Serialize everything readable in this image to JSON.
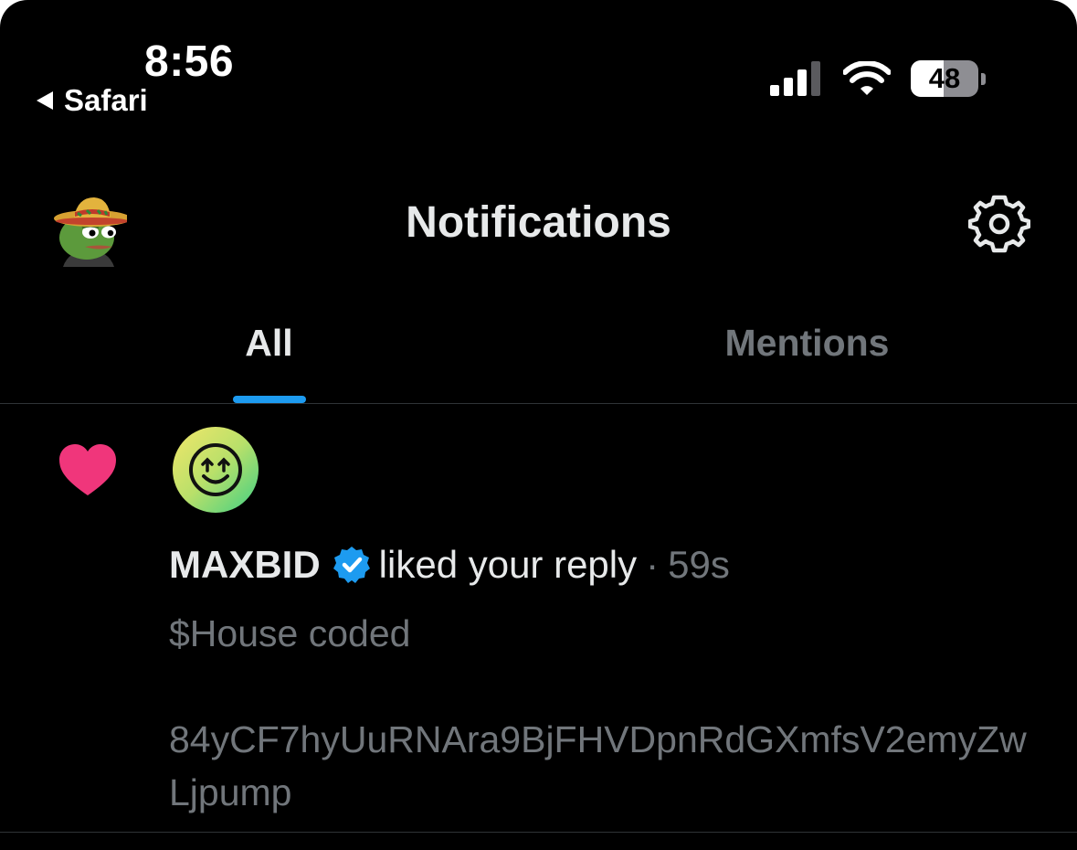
{
  "status_bar": {
    "time": "8:56",
    "back_app": "Safari",
    "battery_level": 48,
    "battery_label": "48",
    "signal_icon": "cellular-signal-icon",
    "wifi_icon": "wifi-icon"
  },
  "header": {
    "title": "Notifications",
    "profile_icon": "profile-avatar",
    "settings_icon": "gear-icon"
  },
  "tabs": [
    {
      "label": "All",
      "active": true
    },
    {
      "label": "Mentions",
      "active": false
    }
  ],
  "notification": {
    "type_icon": "heart-icon",
    "actor_name": "MAXBID",
    "verified_icon": "verified-badge-icon",
    "action": "liked your reply",
    "separator": "·",
    "time_ago": "59s",
    "reply_text": "$House coded\n\n84yCF7hyUuRNAra9BjFHVDpnRdGXmfsV2emyZwLjpump"
  },
  "colors": {
    "background": "#000000",
    "accent": "#1d9bf0",
    "heart": "#f0367b",
    "muted_text": "#71767b",
    "divider": "#2f3336"
  }
}
